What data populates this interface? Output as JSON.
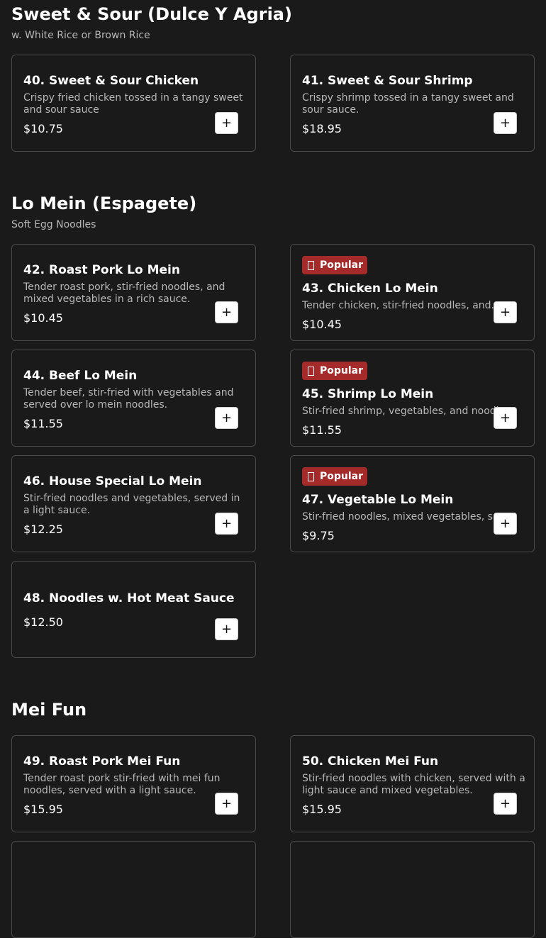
{
  "sections": [
    {
      "title": "Sweet & Sour (Dulce Y Agria)",
      "subtitle": "w. White Rice or Brown Rice",
      "items": [
        {
          "name": "40. Sweet & Sour Chicken",
          "desc": "Crispy fried chicken tossed in a tangy sweet and sour sauce",
          "price": "$10.75"
        },
        {
          "name": "41. Sweet & Sour Shrimp",
          "desc": "Crispy shrimp tossed in a tangy sweet and sour sauce.",
          "price": "$18.95"
        }
      ]
    },
    {
      "title": "Lo Mein (Espagete)",
      "subtitle": "Soft Egg Noodles",
      "items": [
        {
          "name": "42. Roast Pork Lo Mein",
          "desc": "Tender roast pork, stir-fried noodles, and mixed vegetables in a rich sauce.",
          "price": "$10.45"
        },
        {
          "badge": "Popular",
          "name": "43. Chicken Lo Mein",
          "desc": "Tender chicken, stir-fried noodles, and...",
          "price": "$10.45"
        },
        {
          "name": "44. Beef Lo Mein",
          "desc": "Tender beef, stir-fried with vegetables and served over lo mein noodles.",
          "price": "$11.55"
        },
        {
          "badge": "Popular",
          "name": "45. Shrimp Lo Mein",
          "desc": "Stir-fried shrimp, vegetables, and noodles.",
          "price": "$11.55"
        },
        {
          "name": "46. House Special Lo Mein",
          "desc": "Stir-fried noodles and vegetables, served in a light sauce.",
          "price": "$12.25"
        },
        {
          "badge": "Popular",
          "name": "47. Vegetable Lo Mein",
          "desc": "Stir-fried noodles, mixed vegetables, sauce.",
          "price": "$9.75"
        },
        {
          "name": "48. Noodles w. Hot Meat Sauce",
          "price": "$12.50"
        }
      ]
    },
    {
      "title": "Mei Fun",
      "items": [
        {
          "name": "49. Roast Pork Mei Fun",
          "desc": "Tender roast pork stir-fried with mei fun noodles, served with a light sauce.",
          "price": "$15.95"
        },
        {
          "name": "50. Chicken Mei Fun",
          "desc": "Stir-fried noodles with chicken, served with a light sauce and mixed vegetables.",
          "price": "$15.95"
        }
      ]
    }
  ],
  "add_label": "+",
  "icons": {
    "badge_icon": "flame-icon",
    "add_icon": "plus-icon"
  },
  "colors": {
    "background": "#1b1a1a",
    "badge": "#a52a2a",
    "card_border": "#4a4a4a",
    "muted_text": "#b8b8b8"
  }
}
